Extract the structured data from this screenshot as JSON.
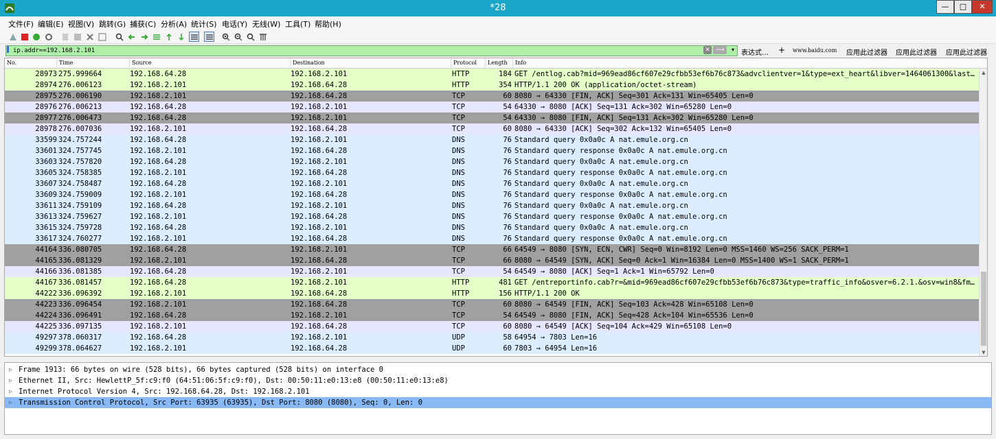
{
  "window": {
    "title": "*28",
    "min_label": "—",
    "max_label": "□",
    "close_label": "✕"
  },
  "menu": [
    "文件(F)",
    "编辑(E)",
    "视图(V)",
    "跳转(G)",
    "捕获(C)",
    "分析(A)",
    "统计(S)",
    "电话(Y)",
    "无线(W)",
    "工具(T)",
    "帮助(H)"
  ],
  "filter": {
    "value": "ip.addr==192.168.2.101",
    "expression_label": "表达式…",
    "plus_label": "+",
    "bookmark_label": "www.baidu.com",
    "apply_buttons": [
      "应用此过滤器",
      "应用此过滤器",
      "应用此过滤器"
    ]
  },
  "columns": [
    "No.",
    "Time",
    "Source",
    "Destination",
    "Protocol",
    "Length",
    "Info"
  ],
  "colors": {
    "http": "#e4ffc7",
    "tcp_light": "#e7e6ff",
    "tcp_dark": "#a0a0a0",
    "dns": "#daeeff",
    "udp": "#daeeff",
    "selected": "#88b9f5"
  },
  "packets": [
    {
      "no": "28973",
      "time": "275.999664",
      "src": "192.168.64.28",
      "dst": "192.168.2.101",
      "proto": "HTTP",
      "len": "184",
      "info": "GET /entlog.cab?mid=969ead86cf607e29cfbb53ef6b76c873&advclientver=1&type=ext_heart&libver=1464061300&last…",
      "style": "http"
    },
    {
      "no": "28974",
      "time": "276.006123",
      "src": "192.168.2.101",
      "dst": "192.168.64.28",
      "proto": "HTTP",
      "len": "354",
      "info": "HTTP/1.1 200 OK  (application/octet-stream)",
      "style": "http"
    },
    {
      "no": "28975",
      "time": "276.006190",
      "src": "192.168.2.101",
      "dst": "192.168.64.28",
      "proto": "TCP",
      "len": "60",
      "info": "8080 → 64330 [FIN, ACK] Seq=301 Ack=131 Win=65405 Len=0",
      "style": "tcp_dark"
    },
    {
      "no": "28976",
      "time": "276.006213",
      "src": "192.168.64.28",
      "dst": "192.168.2.101",
      "proto": "TCP",
      "len": "54",
      "info": "64330 → 8080 [ACK] Seq=131 Ack=302 Win=65280 Len=0",
      "style": "tcp_light"
    },
    {
      "no": "28977",
      "time": "276.006473",
      "src": "192.168.64.28",
      "dst": "192.168.2.101",
      "proto": "TCP",
      "len": "54",
      "info": "64330 → 8080 [FIN, ACK] Seq=131 Ack=302 Win=65280 Len=0",
      "style": "tcp_dark"
    },
    {
      "no": "28978",
      "time": "276.007036",
      "src": "192.168.2.101",
      "dst": "192.168.64.28",
      "proto": "TCP",
      "len": "60",
      "info": "8080 → 64330 [ACK] Seq=302 Ack=132 Win=65405 Len=0",
      "style": "tcp_light"
    },
    {
      "no": "33599",
      "time": "324.757244",
      "src": "192.168.64.28",
      "dst": "192.168.2.101",
      "proto": "DNS",
      "len": "76",
      "info": "Standard query 0x0a0c A nat.emule.org.cn",
      "style": "dns"
    },
    {
      "no": "33601",
      "time": "324.757745",
      "src": "192.168.2.101",
      "dst": "192.168.64.28",
      "proto": "DNS",
      "len": "76",
      "info": "Standard query response 0x0a0c A nat.emule.org.cn",
      "style": "dns"
    },
    {
      "no": "33603",
      "time": "324.757820",
      "src": "192.168.64.28",
      "dst": "192.168.2.101",
      "proto": "DNS",
      "len": "76",
      "info": "Standard query 0x0a0c A nat.emule.org.cn",
      "style": "dns"
    },
    {
      "no": "33605",
      "time": "324.758385",
      "src": "192.168.2.101",
      "dst": "192.168.64.28",
      "proto": "DNS",
      "len": "76",
      "info": "Standard query response 0x0a0c A nat.emule.org.cn",
      "style": "dns"
    },
    {
      "no": "33607",
      "time": "324.758487",
      "src": "192.168.64.28",
      "dst": "192.168.2.101",
      "proto": "DNS",
      "len": "76",
      "info": "Standard query 0x0a0c A nat.emule.org.cn",
      "style": "dns"
    },
    {
      "no": "33609",
      "time": "324.759009",
      "src": "192.168.2.101",
      "dst": "192.168.64.28",
      "proto": "DNS",
      "len": "76",
      "info": "Standard query response 0x0a0c A nat.emule.org.cn",
      "style": "dns"
    },
    {
      "no": "33611",
      "time": "324.759109",
      "src": "192.168.64.28",
      "dst": "192.168.2.101",
      "proto": "DNS",
      "len": "76",
      "info": "Standard query 0x0a0c A nat.emule.org.cn",
      "style": "dns"
    },
    {
      "no": "33613",
      "time": "324.759627",
      "src": "192.168.2.101",
      "dst": "192.168.64.28",
      "proto": "DNS",
      "len": "76",
      "info": "Standard query response 0x0a0c A nat.emule.org.cn",
      "style": "dns"
    },
    {
      "no": "33615",
      "time": "324.759728",
      "src": "192.168.64.28",
      "dst": "192.168.2.101",
      "proto": "DNS",
      "len": "76",
      "info": "Standard query 0x0a0c A nat.emule.org.cn",
      "style": "dns"
    },
    {
      "no": "33617",
      "time": "324.760277",
      "src": "192.168.2.101",
      "dst": "192.168.64.28",
      "proto": "DNS",
      "len": "76",
      "info": "Standard query response 0x0a0c A nat.emule.org.cn",
      "style": "dns"
    },
    {
      "no": "44164",
      "time": "336.080705",
      "src": "192.168.64.28",
      "dst": "192.168.2.101",
      "proto": "TCP",
      "len": "66",
      "info": "64549 → 8080 [SYN, ECN, CWR] Seq=0 Win=8192 Len=0 MSS=1460 WS=256 SACK_PERM=1",
      "style": "tcp_dark"
    },
    {
      "no": "44165",
      "time": "336.081329",
      "src": "192.168.2.101",
      "dst": "192.168.64.28",
      "proto": "TCP",
      "len": "66",
      "info": "8080 → 64549 [SYN, ACK] Seq=0 Ack=1 Win=16384 Len=0 MSS=1400 WS=1 SACK_PERM=1",
      "style": "tcp_dark"
    },
    {
      "no": "44166",
      "time": "336.081385",
      "src": "192.168.64.28",
      "dst": "192.168.2.101",
      "proto": "TCP",
      "len": "54",
      "info": "64549 → 8080 [ACK] Seq=1 Ack=1 Win=65792 Len=0",
      "style": "tcp_light"
    },
    {
      "no": "44167",
      "time": "336.081457",
      "src": "192.168.64.28",
      "dst": "192.168.2.101",
      "proto": "HTTP",
      "len": "481",
      "info": "GET /entreportinfo.cab?r=&mid=969ead86cf607e29cfbb53ef6b76c873&type=traffic_info&osver=6.2.1.&osv=win8&fm…",
      "style": "http"
    },
    {
      "no": "44222",
      "time": "336.096392",
      "src": "192.168.2.101",
      "dst": "192.168.64.28",
      "proto": "HTTP",
      "len": "156",
      "info": "HTTP/1.1 200 OK",
      "style": "http"
    },
    {
      "no": "44223",
      "time": "336.096454",
      "src": "192.168.2.101",
      "dst": "192.168.64.28",
      "proto": "TCP",
      "len": "60",
      "info": "8080 → 64549 [FIN, ACK] Seq=103 Ack=428 Win=65108 Len=0",
      "style": "tcp_dark"
    },
    {
      "no": "44224",
      "time": "336.096491",
      "src": "192.168.64.28",
      "dst": "192.168.2.101",
      "proto": "TCP",
      "len": "54",
      "info": "64549 → 8080 [FIN, ACK] Seq=428 Ack=104 Win=65536 Len=0",
      "style": "tcp_dark"
    },
    {
      "no": "44225",
      "time": "336.097135",
      "src": "192.168.2.101",
      "dst": "192.168.64.28",
      "proto": "TCP",
      "len": "60",
      "info": "8080 → 64549 [ACK] Seq=104 Ack=429 Win=65108 Len=0",
      "style": "tcp_light"
    },
    {
      "no": "49297",
      "time": "378.060317",
      "src": "192.168.64.28",
      "dst": "192.168.2.101",
      "proto": "UDP",
      "len": "58",
      "info": "64954 → 7803  Len=16",
      "style": "udp"
    },
    {
      "no": "49299",
      "time": "378.064627",
      "src": "192.168.2.101",
      "dst": "192.168.64.28",
      "proto": "UDP",
      "len": "60",
      "info": "7803 → 64954  Len=16",
      "style": "udp"
    }
  ],
  "details": [
    {
      "text": "Frame 1913: 66 bytes on wire (528 bits), 66 bytes captured (528 bits) on interface 0",
      "selected": false
    },
    {
      "text": "Ethernet II, Src: HewlettP_5f:c9:f0 (64:51:06:5f:c9:f0), Dst: 00:50:11:e0:13:e8 (00:50:11:e0:13:e8)",
      "selected": false
    },
    {
      "text": "Internet Protocol Version 4, Src: 192.168.64.28, Dst: 192.168.2.101",
      "selected": false
    },
    {
      "text": "Transmission Control Protocol, Src Port: 63935 (63935), Dst Port: 8080 (8080), Seq: 0, Len: 0",
      "selected": true
    }
  ]
}
